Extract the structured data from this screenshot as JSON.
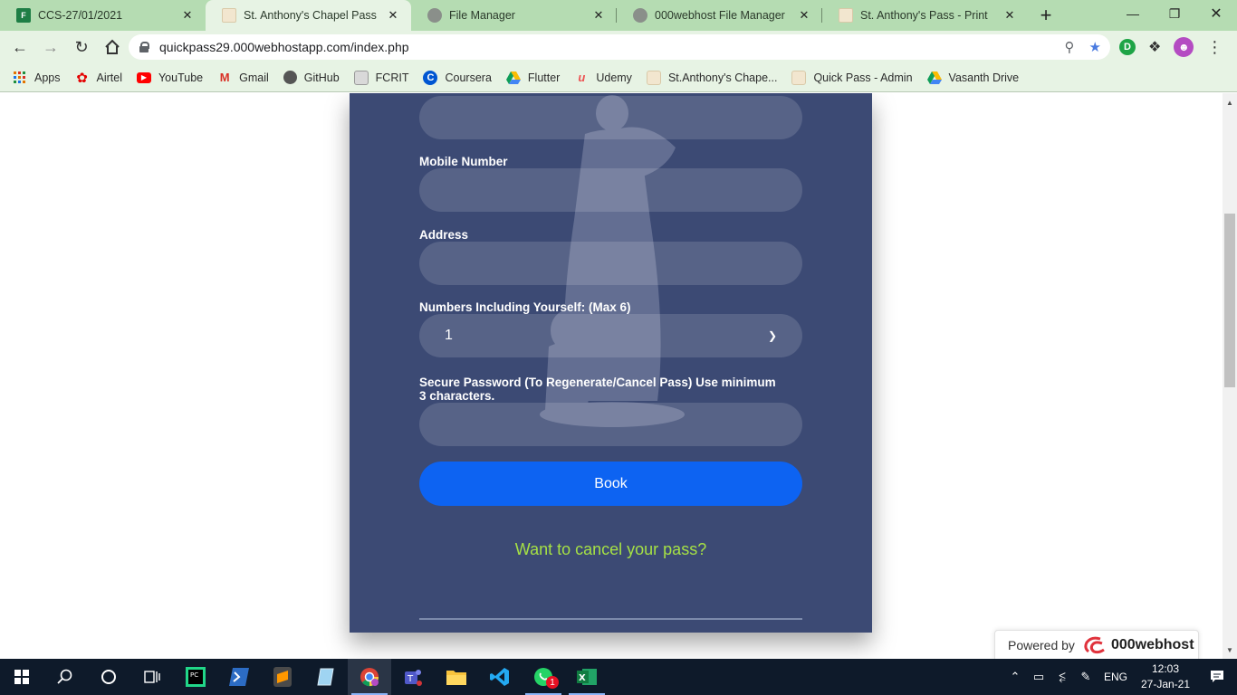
{
  "browser": {
    "tabs": [
      {
        "title": "CCS-27/01/2021",
        "favicon_color": "#1e7e45",
        "favicon_text": "F"
      },
      {
        "title": "St. Anthony's Chapel Pass",
        "favicon_color": "#f2e6cf",
        "favicon_text": "",
        "active": true
      },
      {
        "title": "File Manager",
        "favicon_color": "#777777",
        "favicon_text": ""
      },
      {
        "title": "000webhost File Manager",
        "favicon_color": "#777777",
        "favicon_text": ""
      },
      {
        "title": "St. Anthony's Pass - Print",
        "favicon_color": "#f2e6cf",
        "favicon_text": ""
      }
    ],
    "new_tab_label": "+",
    "url": "quickpass29.000webhostapp.com/index.php",
    "profile_initial": "D",
    "bookmarks": [
      {
        "label": "Apps",
        "icon": "apps-grid-icon"
      },
      {
        "label": "Airtel",
        "icon": "airtel-icon"
      },
      {
        "label": "YouTube",
        "icon": "youtube-icon"
      },
      {
        "label": "Gmail",
        "icon": "gmail-icon"
      },
      {
        "label": "GitHub",
        "icon": "github-icon"
      },
      {
        "label": "FCRIT",
        "icon": "fcrit-icon"
      },
      {
        "label": "Coursera",
        "icon": "coursera-icon"
      },
      {
        "label": "Flutter",
        "icon": "drive-icon"
      },
      {
        "label": "Udemy",
        "icon": "udemy-icon"
      },
      {
        "label": "St.Anthony's Chape...",
        "icon": "chapel-icon"
      },
      {
        "label": "Quick Pass - Admin",
        "icon": "chapel-icon"
      },
      {
        "label": "Vasanth Drive",
        "icon": "drive-icon"
      }
    ]
  },
  "form": {
    "mobile_label": "Mobile Number",
    "mobile_value": "",
    "address_label": "Address",
    "address_value": "",
    "numbers_label": "Numbers Including Yourself: (Max 6)",
    "numbers_selected": "1",
    "password_label": "Secure Password (To Regenerate/Cancel Pass) Use minimum 3 characters.",
    "password_value": "",
    "book_button": "Book",
    "cancel_link": "Want to cancel your pass?"
  },
  "powered_by": {
    "prefix": "Powered by",
    "brand": "000webhost"
  },
  "taskbar": {
    "language": "ENG",
    "time": "12:03",
    "date": "27-Jan-21",
    "whatsapp_badge": "1"
  },
  "colors": {
    "tabstrip": "#b5dcb2",
    "toolbar": "#e7f3e4",
    "card": "#3c4a74",
    "book_button": "#0d63f2",
    "cancel_link": "#a5e045"
  }
}
